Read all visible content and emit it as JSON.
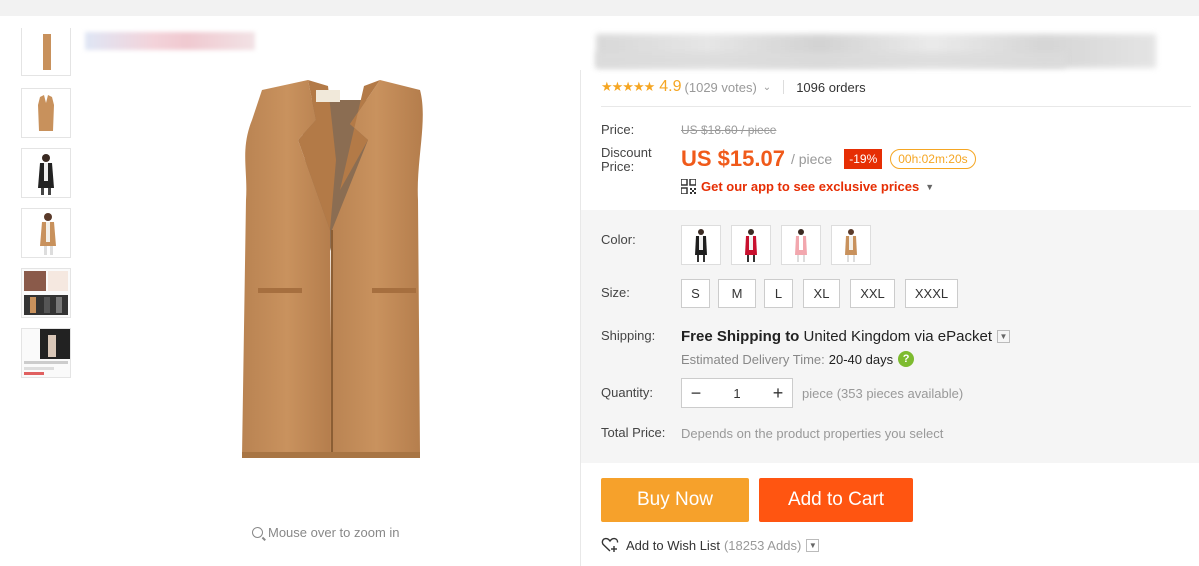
{
  "product": {
    "rating_stars": "★★★★★",
    "rating": "4.9",
    "votes": "(1029 votes)",
    "orders": "1096 orders"
  },
  "pricing": {
    "price_label": "Price:",
    "original_price": "US $18.60 / piece",
    "discount_label_1": "Discount",
    "discount_label_2": "Price:",
    "price": "US $15.07",
    "per": "/ piece",
    "discount_pct": "-19%",
    "countdown": "00h:02m:20s",
    "app_promo": "Get our app to see exclusive prices"
  },
  "options": {
    "color_label": "Color:",
    "size_label": "Size:",
    "colors": [
      "black",
      "red",
      "pink",
      "camel"
    ],
    "sizes": [
      "S",
      "M",
      "L",
      "XL",
      "XXL",
      "XXXL"
    ]
  },
  "shipping": {
    "label": "Shipping:",
    "free_text": "Free Shipping",
    "to_text": "to",
    "destination": "United Kingdom",
    "via_text": "via",
    "carrier": "ePacket",
    "estimate_label": "Estimated Delivery Time:",
    "estimate_value": "20-40 days"
  },
  "quantity": {
    "label": "Quantity:",
    "value": "1",
    "note": "piece (353 pieces available)"
  },
  "total": {
    "label": "Total Price:",
    "note": "Depends on the product properties you select"
  },
  "actions": {
    "buy_now": "Buy Now",
    "add_to_cart": "Add to Cart",
    "wish_list": "Add to Wish List",
    "wish_count": "(18253 Adds)"
  },
  "gallery": {
    "zoom_hint": "Mouse over to zoom in"
  },
  "colors": {
    "accent_orange": "#f05a1a",
    "buy_now_bg": "#f6a12b",
    "add_to_cart_bg": "#ff5511",
    "discount_red": "#e62e04",
    "star": "#f5a623",
    "vest_camel": "#c8915c"
  }
}
